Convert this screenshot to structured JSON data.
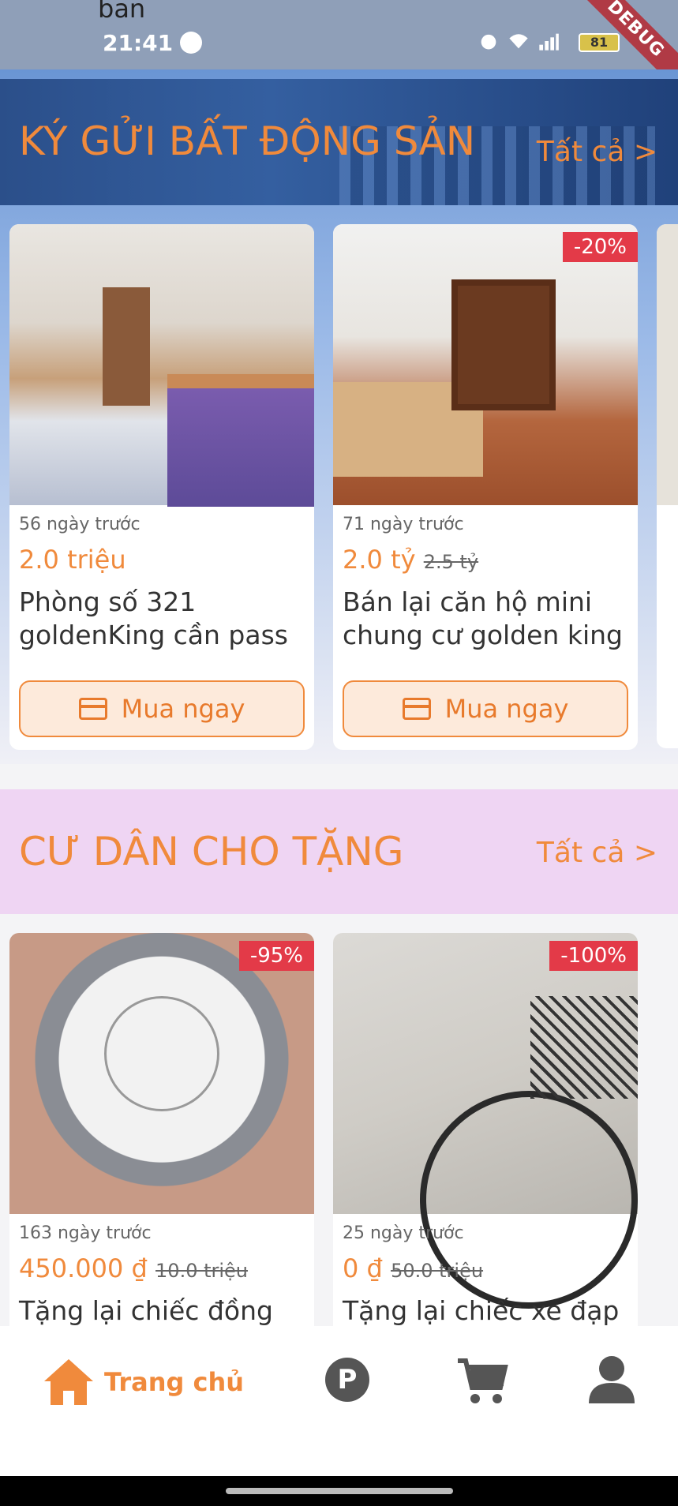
{
  "status_bar": {
    "top_text": "ban",
    "time": "21:41",
    "battery": "81",
    "debug_label": "DEBUG"
  },
  "section_real_estate": {
    "title": "KÝ GỬI BẤT ĐỘNG SẢN",
    "see_all": "Tất cả >",
    "items": [
      {
        "ago": "56 ngày trước",
        "price": "2.0 triệu",
        "old_price": "",
        "discount": "",
        "name": "Phòng số 321 goldenKing cần pass",
        "buy_label": "Mua ngay"
      },
      {
        "ago": "71 ngày trước",
        "price": "2.0 tỷ",
        "old_price": "2.5 tỷ",
        "discount": "-20%",
        "name": "Bán lại căn hộ mini chung cư golden king",
        "buy_label": "Mua ngay"
      }
    ]
  },
  "section_gifts": {
    "title": "CƯ DÂN CHO TẶNG",
    "see_all": "Tất cả >",
    "items": [
      {
        "ago": "163 ngày trước",
        "price": "450.000 ₫",
        "old_price": "10.0 triệu",
        "discount": "-95%",
        "name": "Tặng lại chiếc đồng hồ"
      },
      {
        "ago": "25 ngày trước",
        "price": "0 ₫",
        "old_price": "50.0 triệu",
        "discount": "-100%",
        "name": "Tặng lại chiếc xe đạp"
      }
    ]
  },
  "bottom_nav": {
    "home_label": "Trang chủ",
    "p_label": "P"
  },
  "colors": {
    "accent": "#f08a3c",
    "discount_badge": "#e33a48",
    "gift_section_bg": "#efd5f3"
  }
}
